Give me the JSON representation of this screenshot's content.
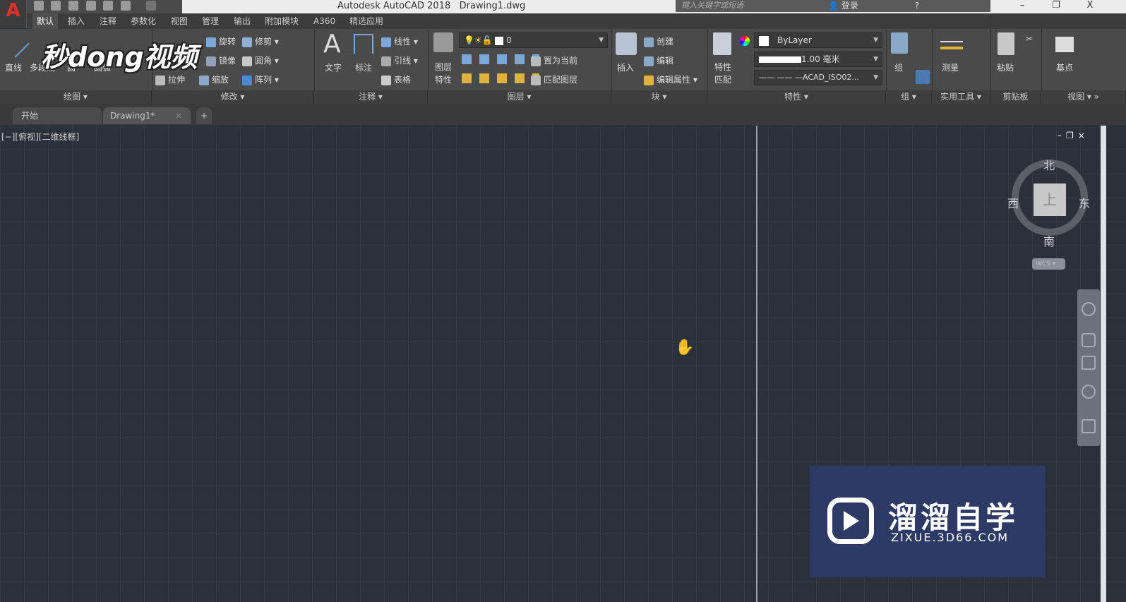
{
  "titlebar": {
    "app_title": "Autodesk AutoCAD 2018",
    "doc_title": "Drawing1.dwg",
    "search_placeholder": "键入关键字或短语",
    "login": "登录",
    "minimize": "–",
    "restore": "❐",
    "close": "X",
    "app_logo": "A"
  },
  "ribbon_tabs": [
    "默认",
    "插入",
    "注释",
    "参数化",
    "视图",
    "管理",
    "输出",
    "附加模块",
    "A360",
    "精选应用"
  ],
  "draw": {
    "line": "直线",
    "polyline": "多段线",
    "circle": "圆",
    "arc": "圆弧",
    "title": "绘图"
  },
  "modify": {
    "rotate": "旋转",
    "trim": "修剪",
    "mirror": "镜像",
    "fillet": "圆角",
    "stretch": "拉伸",
    "scale": "缩放",
    "array": "阵列",
    "title": "修改"
  },
  "annotation": {
    "text": "文字",
    "dimension": "标注",
    "linear": "线性",
    "leader": "引线",
    "table": "表格",
    "title": "注释"
  },
  "layers": {
    "layer_props_1": "图层",
    "layer_props_2": "特性",
    "current_layer": "0",
    "set_current": "置为当前",
    "match_layer": "匹配图层",
    "title": "图层"
  },
  "block": {
    "insert": "插入",
    "create": "创建",
    "edit": "编辑",
    "edit_attributes": "编辑属性",
    "title": "块"
  },
  "properties": {
    "match_1": "特性",
    "match_2": "匹配",
    "color": "ByLayer",
    "lineweight": "1.00 毫米",
    "linetype": "——  ——  —ACAD_ISO02...",
    "title": "特性"
  },
  "groups": {
    "group": "组",
    "title": "组"
  },
  "utilities": {
    "measure": "测量",
    "title": "实用工具"
  },
  "clipboard": {
    "paste": "粘贴",
    "title": "剪贴板"
  },
  "view": {
    "base": "基点",
    "title": "视图"
  },
  "doc_tabs": [
    {
      "label": "开始"
    },
    {
      "label": "Drawing1*",
      "close": "×"
    }
  ],
  "new_tab": "+",
  "viewport": {
    "label": "[−][俯视][二维线框]",
    "controls": "–❐×"
  },
  "viewcube": {
    "north": "北",
    "south": "南",
    "east": "东",
    "west": "西",
    "face": "上",
    "wcs": "WCS ▾"
  },
  "watermark": {
    "overlay": "秒dong视频",
    "title": "溜溜自学",
    "url": "ZIXUE.3D66.COM"
  }
}
